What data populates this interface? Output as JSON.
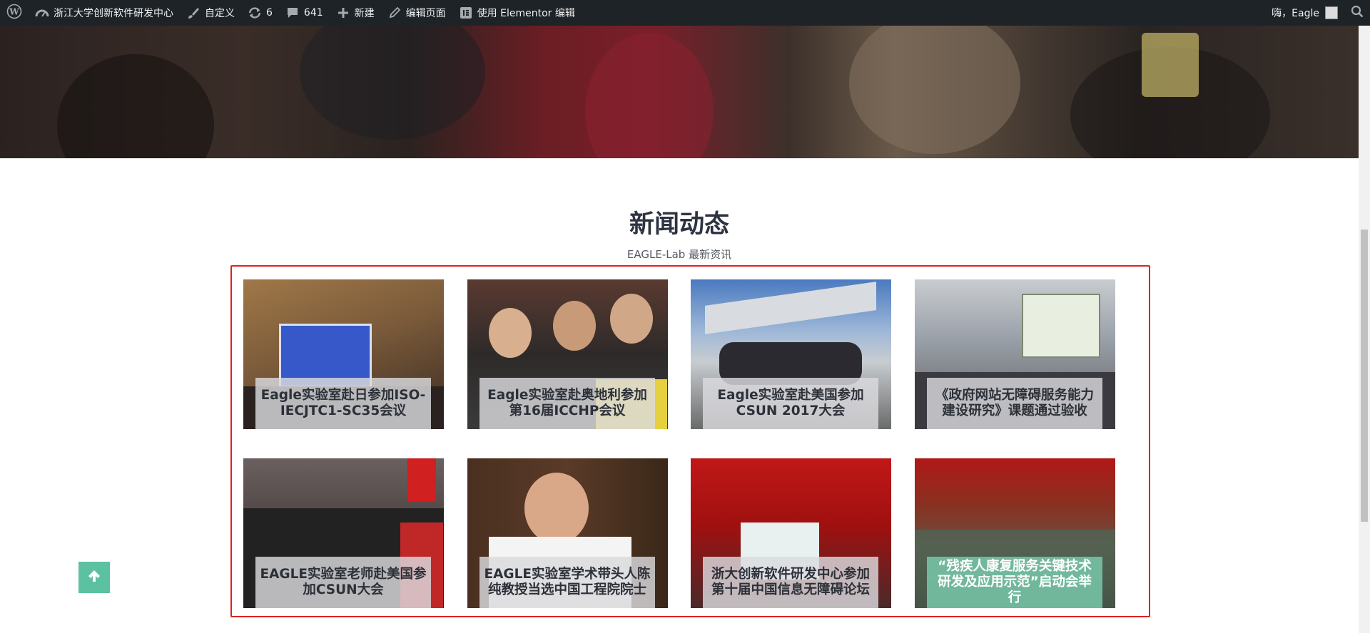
{
  "adminbar": {
    "site_name": "浙江大学创新软件研发中心",
    "customize": "自定义",
    "updates_count": "6",
    "comments_count": "641",
    "new_label": "新建",
    "edit_page": "编辑页面",
    "elementor_edit": "使用 Elementor 编辑",
    "greeting": "嗨，Eagle"
  },
  "section": {
    "title": "新闻动态",
    "subtitle": "EAGLE-Lab 最新资讯"
  },
  "news": [
    {
      "caption": "Eagle实验室赴日参加ISO-IECJTC1-SC35会议"
    },
    {
      "caption": "Eagle实验室赴奥地利参加第16届ICCHP会议"
    },
    {
      "caption": "Eagle实验室赴美国参加CSUN 2017大会"
    },
    {
      "caption": "《政府网站无障碍服务能力建设研究》课题通过验收"
    },
    {
      "caption": "EAGLE实验室老师赴美国参加CSUN大会"
    },
    {
      "caption": "EAGLE实验室学术带头人陈纯教授当选中国工程院院士"
    },
    {
      "caption": "浙大创新软件研发中心参加第十届中国信息无障碍论坛"
    },
    {
      "caption": "“残疾人康复服务关键技术研发及应用示范”启动会举行"
    }
  ],
  "colors": {
    "adminbar_bg": "#1d2327",
    "accent_green": "#5cc1a0",
    "selection_red": "#e02020"
  },
  "icons": {
    "wp_logo": "wordpress-icon",
    "dashboard": "dashboard-icon",
    "customize": "brush-icon",
    "updates": "updates-icon",
    "comments": "comment-icon",
    "new": "plus-icon",
    "edit": "pencil-icon",
    "elementor": "elementor-icon",
    "search": "search-icon",
    "back_to_top": "arrow-up-icon"
  }
}
